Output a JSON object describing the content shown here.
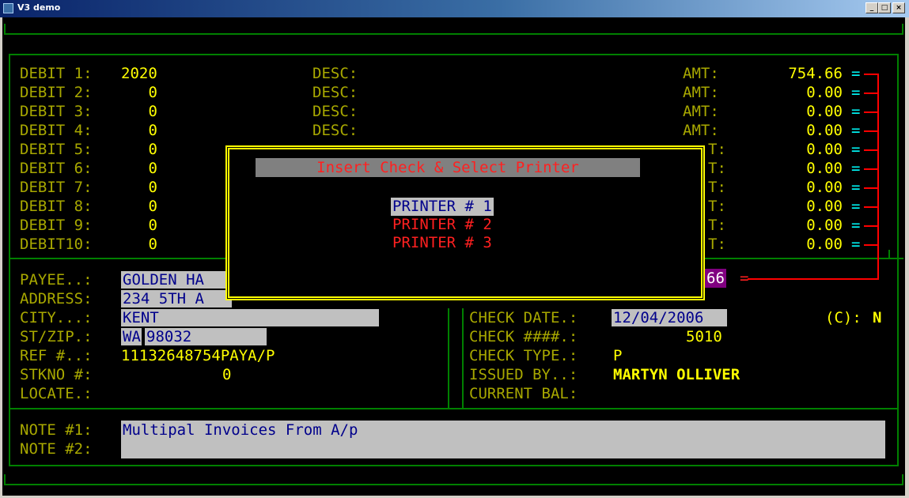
{
  "window": {
    "title": "V3 demo",
    "min_label": "_",
    "max_label": "□",
    "close_label": "×"
  },
  "debits": [
    {
      "label": "DEBIT 1:",
      "value": "2020",
      "desc": "DESC:",
      "amt_label": "AMT:",
      "amount": "754.66"
    },
    {
      "label": "DEBIT 2:",
      "value": "0",
      "desc": "DESC:",
      "amt_label": "AMT:",
      "amount": "0.00"
    },
    {
      "label": "DEBIT 3:",
      "value": "0",
      "desc": "DESC:",
      "amt_label": "AMT:",
      "amount": "0.00"
    },
    {
      "label": "DEBIT 4:",
      "value": "0",
      "desc": "DESC:",
      "amt_label": "AMT:",
      "amount": "0.00"
    },
    {
      "label": "DEBIT 5:",
      "value": "0",
      "amt_label": "T:",
      "amount": "0.00"
    },
    {
      "label": "DEBIT 6:",
      "value": "0",
      "amt_label": "T:",
      "amount": "0.00"
    },
    {
      "label": "DEBIT 7:",
      "value": "0",
      "amt_label": "T:",
      "amount": "0.00"
    },
    {
      "label": "DEBIT 8:",
      "value": "0",
      "amt_label": "T:",
      "amount": "0.00"
    },
    {
      "label": "DEBIT 9:",
      "value": "0",
      "amt_label": "T:",
      "amount": "0.00"
    },
    {
      "label": "DEBIT10:",
      "value": "0",
      "amt_label": "T:",
      "amount": "0.00"
    }
  ],
  "equals_marker": "=",
  "total": {
    "value": "66",
    "marker": "="
  },
  "payee": {
    "payee_label": "PAYEE..:",
    "payee": "GOLDEN HA",
    "address_label": "ADDRESS:",
    "address": "234 5TH A",
    "city_label": "CITY...:",
    "city": "KENT",
    "stzip_label": "ST/ZIP.:",
    "state": "WA",
    "zip": "98032",
    "ref_label": "REF #..:",
    "ref": "11132648754PAYA/P",
    "stkno_label": "STKNO #:",
    "stkno": "0",
    "locate_label": "LOCATE.:"
  },
  "check": {
    "date_label": "CHECK DATE.:",
    "date": "12/04/2006",
    "number_label": "CHECK ####.:",
    "number": "5010",
    "type_label": "CHECK TYPE.:",
    "type": "P",
    "issued_label": "ISSUED BY..:",
    "issued_by": "MARTYN OLLIVER",
    "balance_label": "CURRENT BAL:",
    "c_label": "(C):",
    "c_value": "N"
  },
  "notes": {
    "note1_label": "NOTE #1:",
    "note1": "Multipal Invoices From A/p",
    "note2_label": "NOTE #2:",
    "note2": ""
  },
  "dialog": {
    "title": "Insert Check & Select Printer",
    "printers": [
      "PRINTER # 1",
      "PRINTER # 2",
      "PRINTER # 3"
    ],
    "selected_index": 0
  },
  "colors": {
    "frame": "#008000",
    "label": "#a8a800",
    "value": "#ffff00",
    "field_bg": "#c0c0c0",
    "field_text": "#00008b",
    "accent_red": "#ff0000"
  }
}
